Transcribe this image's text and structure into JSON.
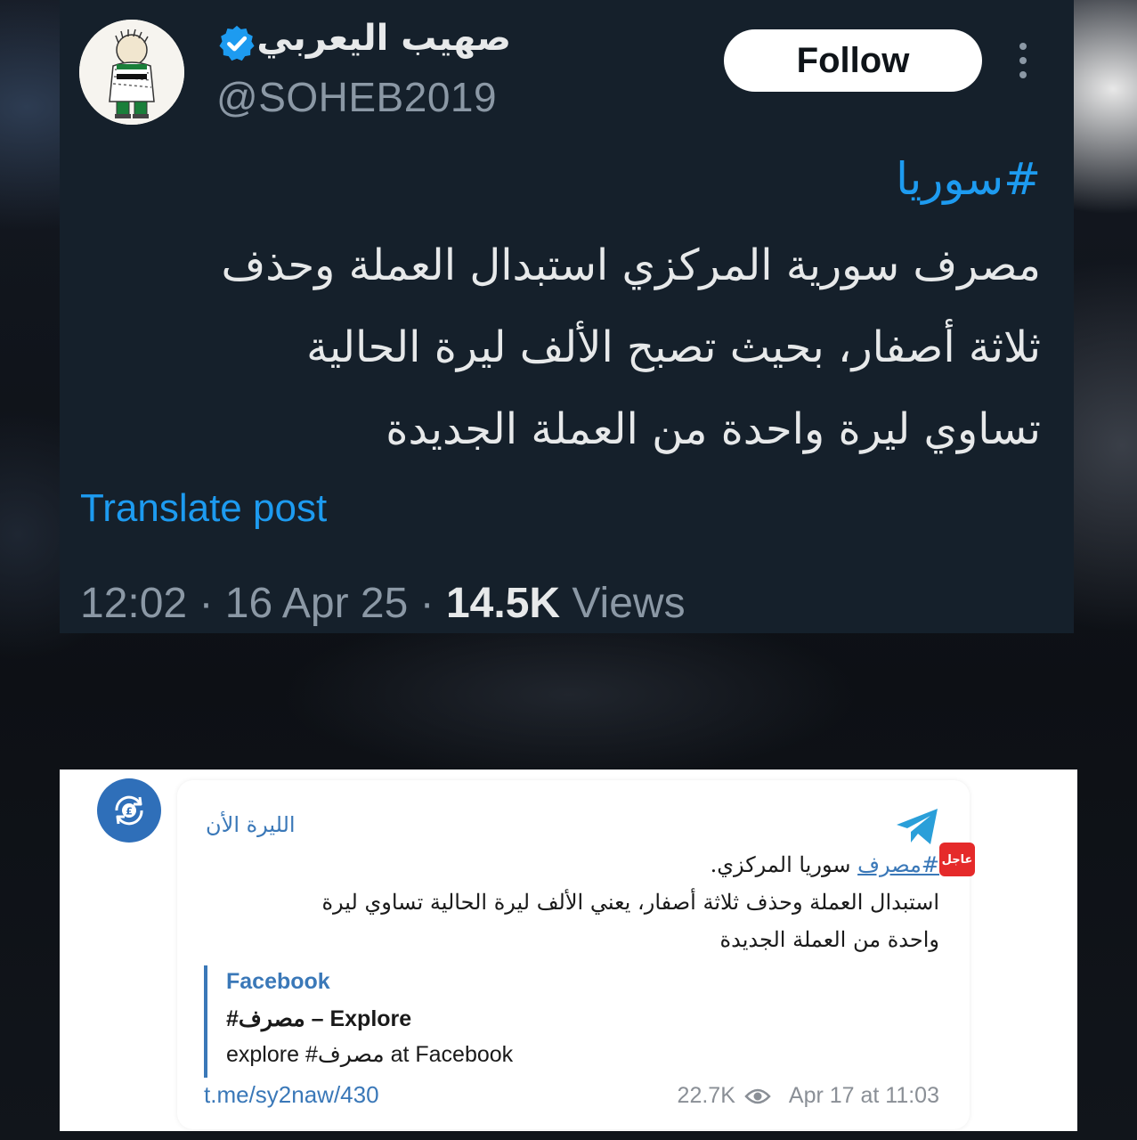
{
  "tweet": {
    "user_name": "صهيب اليعربي",
    "handle": "@SOHEB2019",
    "follow_label": "Follow",
    "hashtag": "#سوريا",
    "body_lines": [
      "مصرف سورية المركزي استبدال العملة وحذف",
      "ثلاثة أصفار، بحيث تصبح الألف ليرة الحالية",
      "تساوي ليرة واحدة من العملة الجديدة"
    ],
    "translate_label": "Translate post",
    "time": "12:02",
    "date": "16 Apr 25",
    "views_count": "14.5K",
    "views_label": "Views",
    "separator": "·",
    "colors": {
      "background": "#15202b",
      "accent": "#1d9bf0",
      "muted": "#8b98a5"
    },
    "icons": {
      "verified": "verified-badge-icon",
      "more": "more-vertical-icon"
    }
  },
  "telegram": {
    "channel_name": "الليرة الأن",
    "breaking_badge": "عاجل",
    "message": {
      "hashtag": "#مصرف",
      "line1_rest": " سوريا المركزي.",
      "line2": "استبدال العملة وحذف ثلاثة أصفار، يعني الألف ليرة الحالية تساوي ليرة",
      "line3": "واحدة من العملة الجديدة"
    },
    "preview": {
      "site": "Facebook",
      "title": "#مصرف – Explore",
      "description": "explore #مصرف at Facebook"
    },
    "link": "t.me/sy2naw/430",
    "views": "22.7K",
    "date": "Apr 17 at 11:03",
    "colors": {
      "accent": "#3a78b8",
      "badge": "#e52a2a",
      "plane": "#2a9fd9"
    },
    "icons": {
      "avatar": "currency-exchange-icon",
      "plane": "telegram-plane-icon",
      "views": "eye-icon"
    }
  }
}
